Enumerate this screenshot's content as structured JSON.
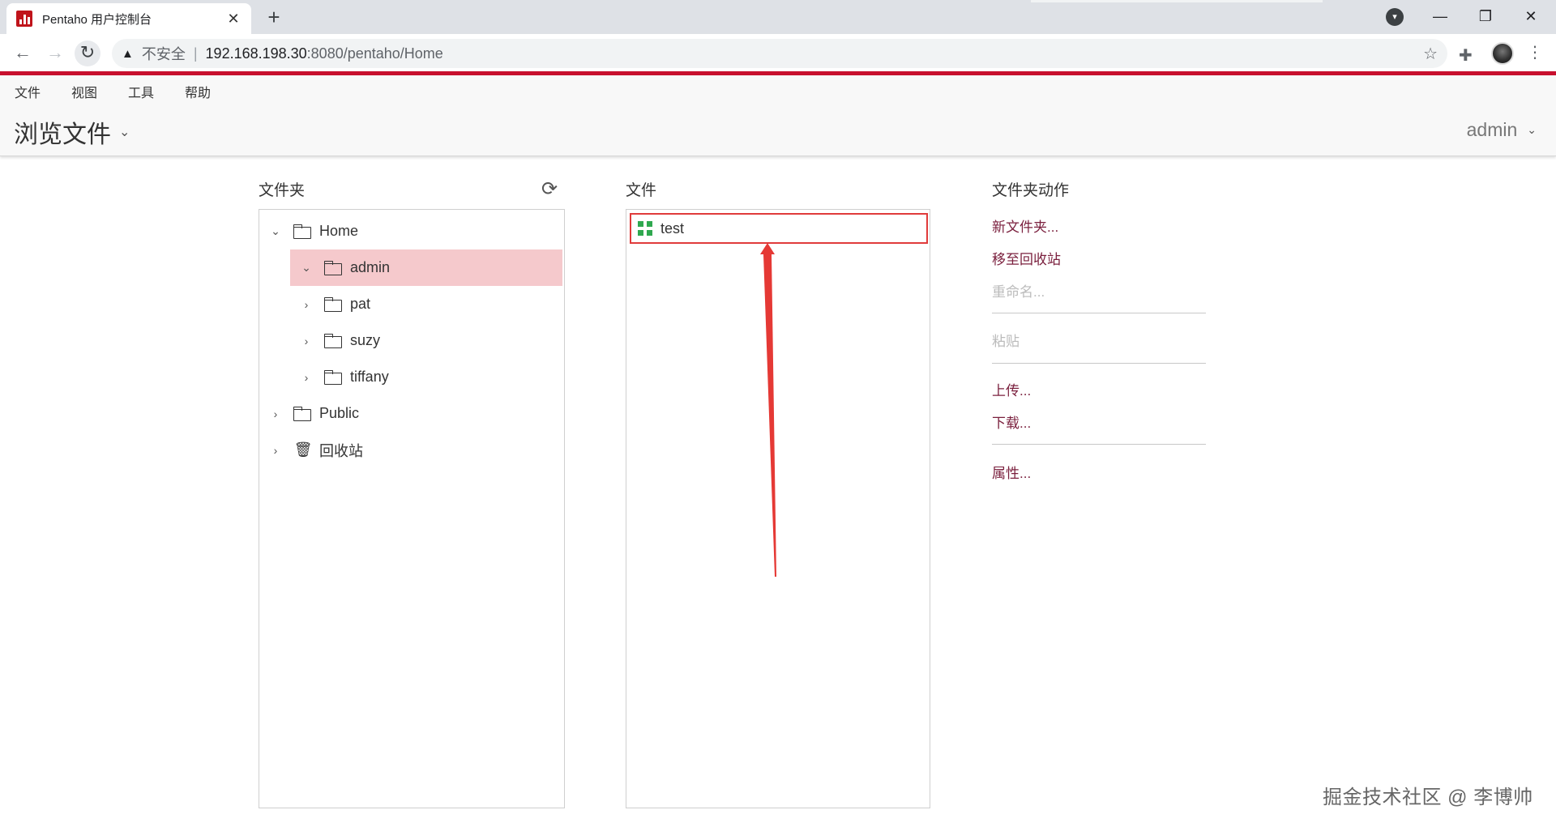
{
  "browser": {
    "tab_title": "Pentaho 用户控制台",
    "tab_close": "✕",
    "new_tab": "+",
    "security_label": "不安全",
    "separator": "|",
    "url_host": "192.168.198.30",
    "url_path": ":8080/pentaho/Home",
    "window_controls": {
      "minimize": "—",
      "restore": "❐",
      "close": "✕"
    }
  },
  "app": {
    "menu": [
      "文件",
      "视图",
      "工具",
      "帮助"
    ],
    "perspective": "浏览文件",
    "user": "admin"
  },
  "folders_panel": {
    "title": "文件夹",
    "tree": [
      {
        "label": "Home",
        "expanded": true,
        "level": 0,
        "icon": "folder-open-icon"
      },
      {
        "label": "admin",
        "expanded": true,
        "level": 1,
        "selected": true,
        "icon": "folder-open-icon"
      },
      {
        "label": "pat",
        "expanded": false,
        "level": 1,
        "icon": "folder-icon"
      },
      {
        "label": "suzy",
        "expanded": false,
        "level": 1,
        "icon": "folder-icon"
      },
      {
        "label": "tiffany",
        "expanded": false,
        "level": 1,
        "icon": "folder-icon"
      },
      {
        "label": "Public",
        "expanded": false,
        "level": 0,
        "icon": "folder-icon"
      },
      {
        "label": "回收站",
        "expanded": false,
        "level": 0,
        "icon": "trash-icon"
      }
    ]
  },
  "files_panel": {
    "title": "文件",
    "files": [
      {
        "name": "test",
        "icon": "transformation-icon"
      }
    ]
  },
  "actions_panel": {
    "title": "文件夹动作",
    "new_folder": "新文件夹...",
    "move_to_trash": "移至回收站",
    "rename": "重命名...",
    "paste": "粘贴",
    "upload": "上传...",
    "download": "下载...",
    "properties": "属性..."
  },
  "watermark": "掘金技术社区 @ 李博帅",
  "colors": {
    "accent_red": "#c8102e",
    "selection": "#f5c9cc",
    "action_link": "#7a1f3d",
    "highlight_box": "#e03b3b"
  }
}
